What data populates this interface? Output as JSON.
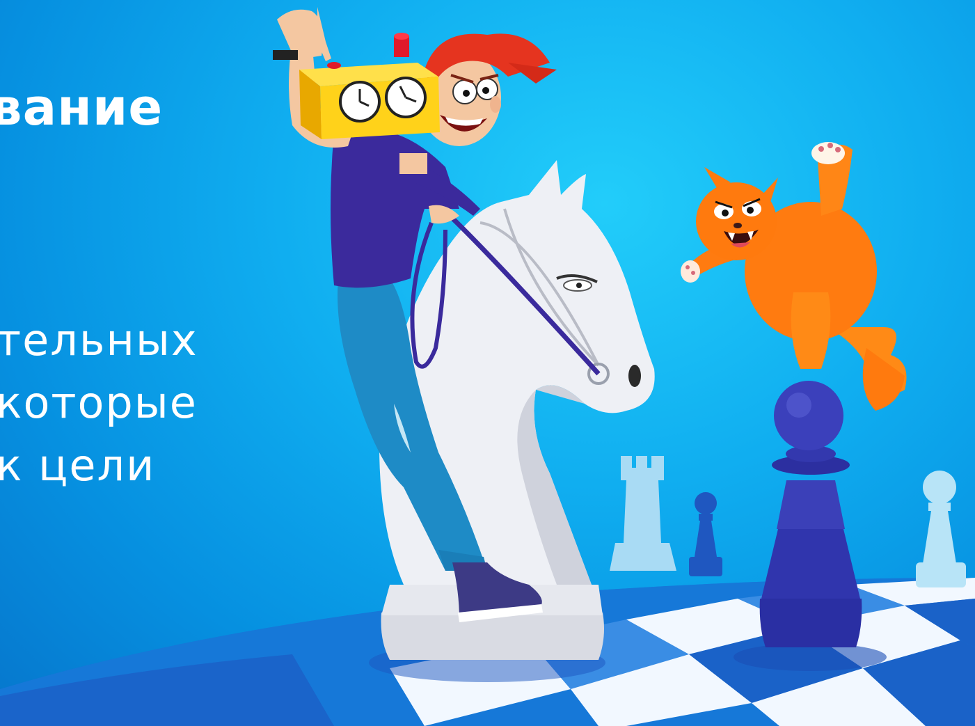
{
  "banner": {
    "heading": "вание",
    "lines": [
      "тельных",
      "которые",
      "к цели"
    ]
  },
  "illustration": {
    "subjects": [
      "man-riding-knight",
      "chess-clock",
      "orange-cat",
      "dark-pawn",
      "rook",
      "small-pawns",
      "checkerboard"
    ]
  },
  "colors": {
    "background": "#10aef0",
    "text": "#ffffff",
    "board_light": "#ffffff",
    "board_dark": "#1a68d6",
    "dark_piece": "#2e2fa6",
    "cat": "#ff7b10",
    "clock": "#ffd21a",
    "shirt": "#3b2a9c",
    "jeans": "#1e8bc6",
    "hair": "#e5341f"
  }
}
